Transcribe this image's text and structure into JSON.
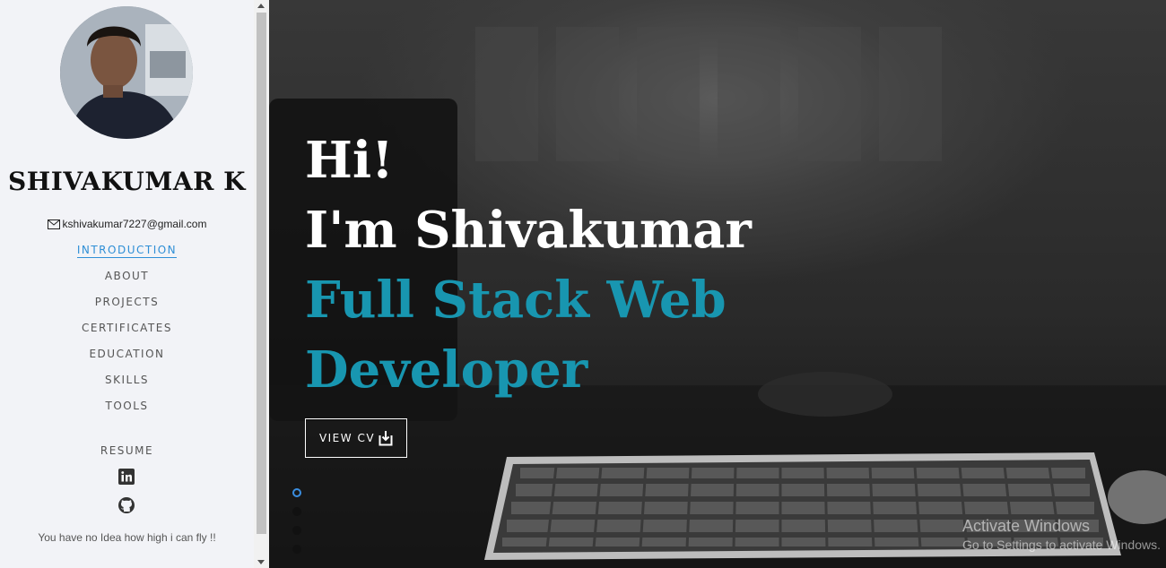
{
  "profile": {
    "name": "SHIVAKUMAR K",
    "email": "kshivakumar7227@gmail.com"
  },
  "nav": {
    "items": [
      {
        "label": "INTRODUCTION",
        "active": true
      },
      {
        "label": "ABOUT",
        "active": false
      },
      {
        "label": "PROJECTS",
        "active": false
      },
      {
        "label": "CERTIFICATES",
        "active": false
      },
      {
        "label": "EDUCATION",
        "active": false
      },
      {
        "label": "SKILLS",
        "active": false
      },
      {
        "label": "TOOLS",
        "active": false
      }
    ],
    "resume_label": "RESUME"
  },
  "social": {
    "icons": [
      "linkedin-icon",
      "github-icon"
    ]
  },
  "tagline": "You have no Idea how high i can fly !!",
  "hero": {
    "line1": "Hi!",
    "line2": "I'm Shivakumar",
    "line3": "Full Stack Web",
    "line4": "Developer",
    "button_label": "VIEW CV"
  },
  "watermark": {
    "title": "Activate Windows",
    "subtitle": "Go to Settings to activate Windows."
  },
  "colors": {
    "accent_teal": "#1896b0",
    "nav_active": "#2f8fd6",
    "sidebar_bg": "#f2f3f7"
  }
}
